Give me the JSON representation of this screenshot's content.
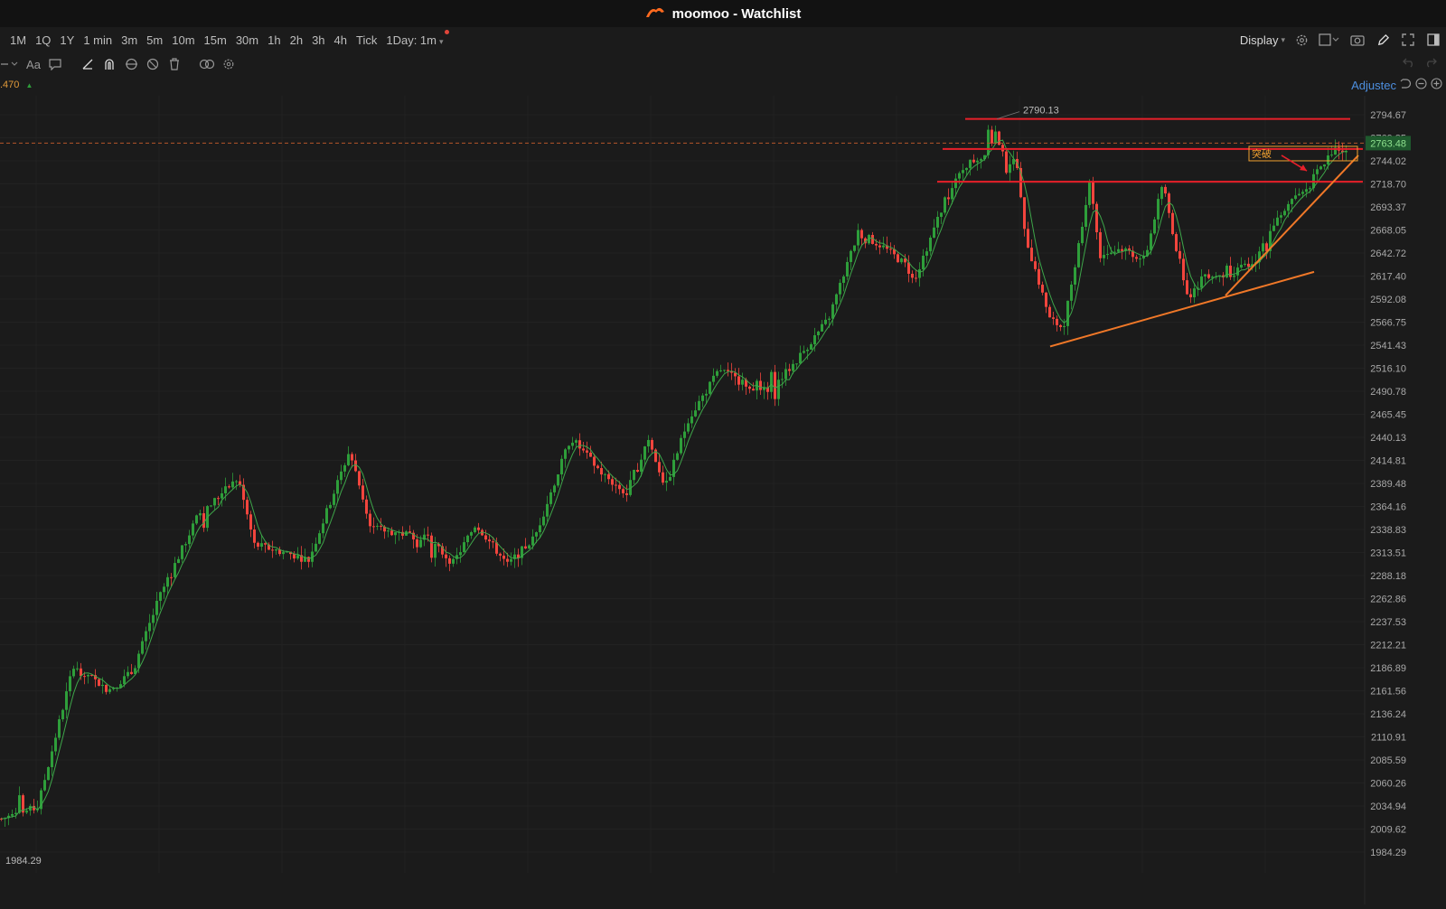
{
  "window": {
    "title": "moomoo - Watchlist",
    "logo_icon": "moomoo-logo-icon"
  },
  "timeframes": [
    {
      "label": "1M"
    },
    {
      "label": "1Q"
    },
    {
      "label": "1Y"
    },
    {
      "label": "1 min"
    },
    {
      "label": "3m"
    },
    {
      "label": "5m"
    },
    {
      "label": "10m"
    },
    {
      "label": "15m"
    },
    {
      "label": "30m"
    },
    {
      "label": "1h"
    },
    {
      "label": "2h"
    },
    {
      "label": "3h"
    },
    {
      "label": "4h"
    },
    {
      "label": "Tick"
    },
    {
      "label": "1Day: 1m",
      "active": true
    }
  ],
  "toolbar": {
    "display_label": "Display",
    "text_tool_label": "Aa"
  },
  "info": {
    "left_value": ".470",
    "adjusted_label": "Adjustec"
  },
  "colors": {
    "background": "#1b1b1b",
    "up": "#2e9e3a",
    "down": "#f1453d",
    "support_line": "#f07828",
    "resistance_line": "#e8202a",
    "price_tag": "#1f5a2e",
    "accent": "#4d8fe0"
  },
  "chart_data": {
    "type": "candlestick",
    "y_ticks": [
      "2794.67",
      "2769.35",
      "2744.02",
      "2718.70",
      "2693.37",
      "2668.05",
      "2642.72",
      "2617.40",
      "2592.08",
      "2566.75",
      "2541.43",
      "2516.10",
      "2490.78",
      "2465.45",
      "2440.13",
      "2414.81",
      "2389.48",
      "2364.16",
      "2338.83",
      "2313.51",
      "2288.18",
      "2262.86",
      "2237.53",
      "2212.21",
      "2186.89",
      "2161.56",
      "2136.24",
      "2110.91",
      "2085.59",
      "2060.26",
      "2034.94",
      "2009.62",
      "1984.29"
    ],
    "ylim": [
      1984.29,
      2794.67
    ],
    "current_price": "2763.48",
    "high_label": "2790.13",
    "low_label": "1984.29",
    "annotation": "突破",
    "anchors": [
      [
        0,
        2021
      ],
      [
        40,
        2033
      ],
      [
        80,
        2190
      ],
      [
        118,
        2162
      ],
      [
        145,
        2182
      ],
      [
        175,
        2265
      ],
      [
        218,
        2355
      ],
      [
        262,
        2395
      ],
      [
        280,
        2322
      ],
      [
        320,
        2312
      ],
      [
        340,
        2305
      ],
      [
        385,
        2425
      ],
      [
        410,
        2340
      ],
      [
        470,
        2330
      ],
      [
        500,
        2302
      ],
      [
        525,
        2345
      ],
      [
        560,
        2300
      ],
      [
        590,
        2330
      ],
      [
        630,
        2440
      ],
      [
        665,
        2400
      ],
      [
        695,
        2375
      ],
      [
        715,
        2440
      ],
      [
        735,
        2385
      ],
      [
        760,
        2460
      ],
      [
        795,
        2515
      ],
      [
        820,
        2500
      ],
      [
        850,
        2490
      ],
      [
        880,
        2525
      ],
      [
        915,
        2570
      ],
      [
        948,
        2665
      ],
      [
        975,
        2650
      ],
      [
        1000,
        2630
      ],
      [
        1010,
        2613
      ],
      [
        1040,
        2690
      ],
      [
        1065,
        2738
      ],
      [
        1090,
        2752
      ],
      [
        1100,
        2775
      ],
      [
        1110,
        2745
      ],
      [
        1125,
        2740
      ],
      [
        1132,
        2665
      ],
      [
        1160,
        2570
      ],
      [
        1175,
        2560
      ],
      [
        1205,
        2725
      ],
      [
        1215,
        2640
      ],
      [
        1240,
        2648
      ],
      [
        1265,
        2635
      ],
      [
        1285,
        2720
      ],
      [
        1300,
        2648
      ],
      [
        1315,
        2590
      ],
      [
        1330,
        2620
      ],
      [
        1355,
        2618
      ],
      [
        1370,
        2625
      ],
      [
        1385,
        2630
      ],
      [
        1410,
        2680
      ],
      [
        1440,
        2710
      ],
      [
        1460,
        2738
      ],
      [
        1475,
        2760
      ],
      [
        1490,
        2752
      ]
    ],
    "resistance_lines": [
      {
        "x1": 1068,
        "x2": 1494,
        "y": 2790.13
      },
      {
        "x1": 1043,
        "x2": 1508,
        "y": 2757
      },
      {
        "x1": 1037,
        "x2": 1508,
        "y": 2721
      }
    ],
    "support_lines": [
      {
        "x1": 1162,
        "y1": 2540,
        "x2": 1454,
        "y2": 2622
      },
      {
        "x1": 1356,
        "y1": 2596,
        "x2": 1503,
        "y2": 2750
      }
    ]
  }
}
